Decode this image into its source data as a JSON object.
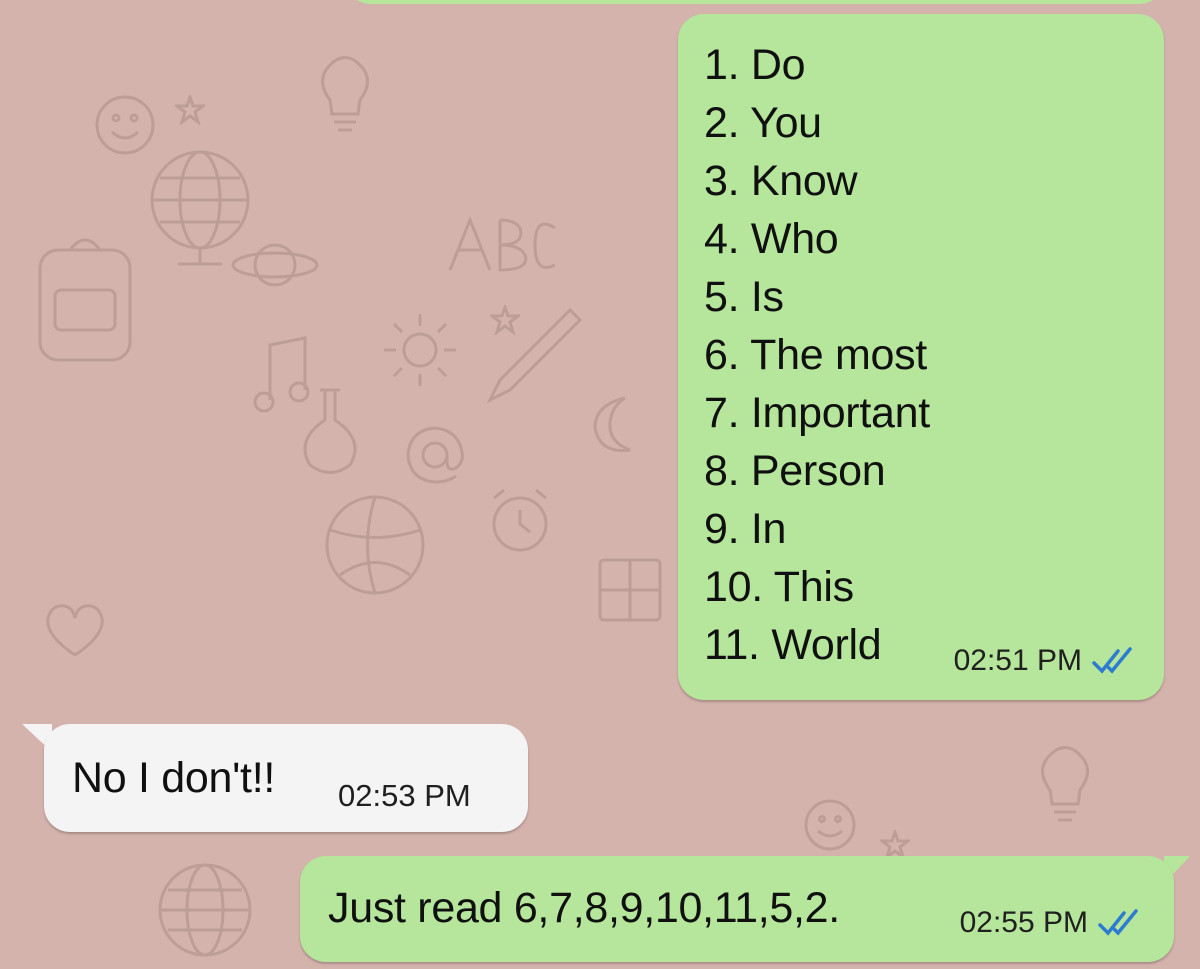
{
  "conversation": {
    "messages": [
      {
        "direction": "outgoing",
        "lines": [
          "1. Do",
          "2. You",
          "3. Know",
          "4. Who",
          "5. Is",
          "6. The most",
          "7. Important",
          "8. Person",
          "9. In",
          "10. This",
          "11. World"
        ],
        "time": "02:51 PM",
        "status_icon": "double-check-read-icon"
      },
      {
        "direction": "incoming",
        "text": "No I don't!!",
        "time": "02:53 PM"
      },
      {
        "direction": "outgoing",
        "text": "Just read 6,7,8,9,10,11,5,2.",
        "time": "02:55 PM",
        "status_icon": "double-check-read-icon"
      }
    ]
  },
  "colors": {
    "background": "#d4b3ad",
    "outgoing_bubble": "#b5e69b",
    "incoming_bubble": "#f4f4f4",
    "read_ticks": "#2e7bd2"
  }
}
